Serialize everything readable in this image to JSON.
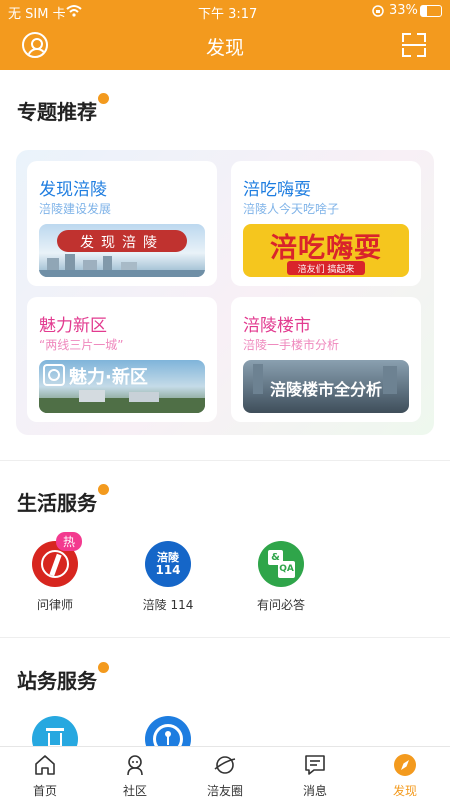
{
  "status": {
    "carrier": "无 SIM 卡",
    "time": "下午 3:17",
    "battery": "33%"
  },
  "nav": {
    "title": "发现"
  },
  "topics": {
    "title": "专题推荐",
    "cards": [
      {
        "title": "发现涪陵",
        "subtitle": "涪陵建设发展",
        "banner": "发现涪陵",
        "title_color": "#1e7de0"
      },
      {
        "title": "涪吃嗨耍",
        "subtitle": "涪陵人今天吃啥子",
        "banner": "涪吃嗨耍",
        "banner_small": "涪友们 搞起来",
        "title_color": "#1e7de0"
      },
      {
        "title": "魅力新区",
        "subtitle": "“两线三片一城”",
        "banner": "魅力·新区",
        "title_color": "#e23a8f"
      },
      {
        "title": "涪陵楼市",
        "subtitle": "涪陵一手楼市分析",
        "banner": "涪陵楼市全分析",
        "title_color": "#e23a8f"
      }
    ]
  },
  "life": {
    "title": "生活服务",
    "items": [
      {
        "label": "问律师",
        "badge": "热",
        "icon": "lawyer-icon"
      },
      {
        "label": "涪陵 114",
        "icon": "fuling-114-icon",
        "icon_text_1": "涪陵",
        "icon_text_2": "114"
      },
      {
        "label": "有问必答",
        "icon": "qa-icon"
      }
    ]
  },
  "station": {
    "title": "站务服务",
    "items": [
      {
        "icon": "trash-icon"
      },
      {
        "icon": "key-icon"
      }
    ]
  },
  "tabs": [
    {
      "label": "首页",
      "icon": "home-icon"
    },
    {
      "label": "社区",
      "icon": "community-icon"
    },
    {
      "label": "涪友圈",
      "icon": "planet-icon"
    },
    {
      "label": "消息",
      "icon": "message-icon"
    },
    {
      "label": "发现",
      "icon": "discover-icon",
      "active": true
    }
  ],
  "colors": {
    "brand": "#f39a1e",
    "blue": "#1e7de0",
    "pink": "#e23a8f"
  }
}
